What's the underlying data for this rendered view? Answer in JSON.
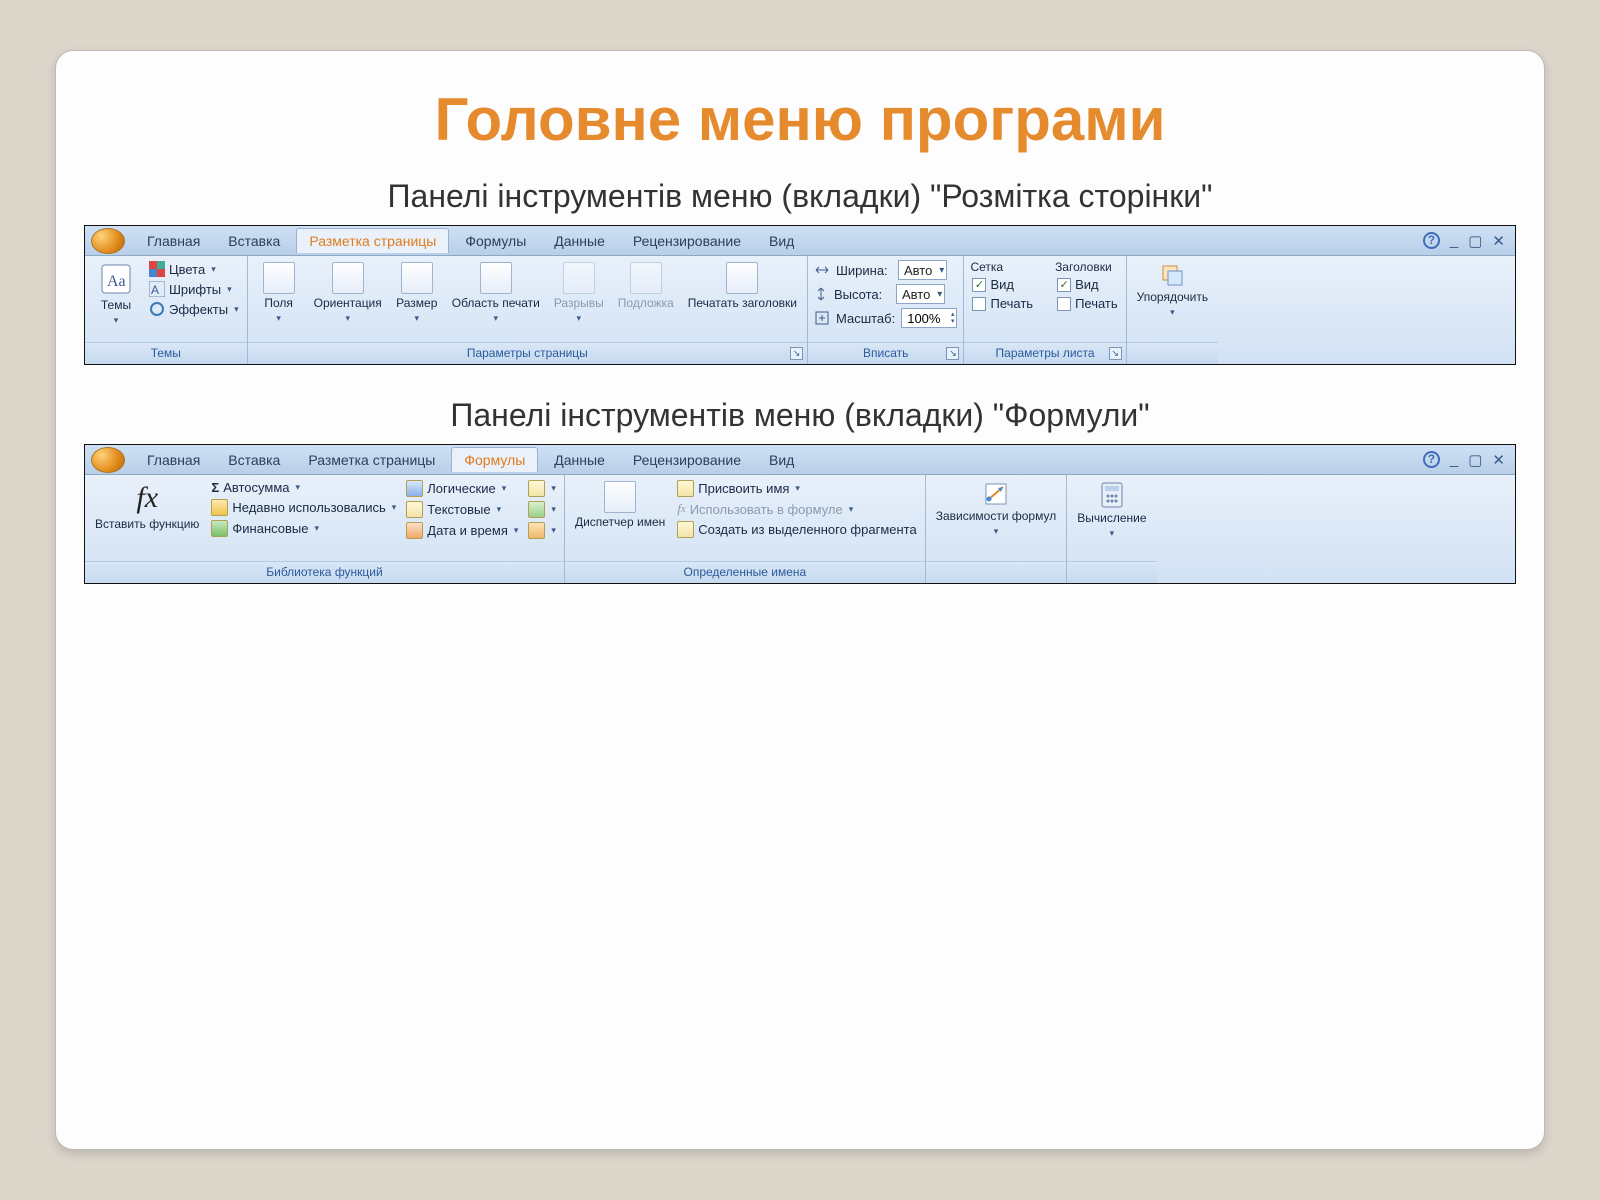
{
  "title": "Головне меню програми",
  "subtitle1": "Панелі інструментів меню (вкладки) \"Розмітка сторінки\"",
  "subtitle2": "Панелі інструментів меню (вкладки) \"Формули\"",
  "tabs": {
    "home": "Главная",
    "insert": "Вставка",
    "pagelayout": "Разметка страницы",
    "formulas": "Формулы",
    "data": "Данные",
    "review": "Рецензирование",
    "view": "Вид"
  },
  "win": {
    "help": "?",
    "min": "_",
    "max": "▢",
    "close": "✕"
  },
  "r1": {
    "themes": {
      "themes_btn": "Темы",
      "colors": "Цвета",
      "fonts": "Шрифты",
      "effects": "Эффекты",
      "group": "Темы"
    },
    "pagesetup": {
      "margins": "Поля",
      "orientation": "Ориентация",
      "size": "Размер",
      "printarea": "Область печати",
      "breaks": "Разрывы",
      "background": "Подложка",
      "printtitles": "Печатать заголовки",
      "group": "Параметры страницы"
    },
    "scale": {
      "width_lbl": "Ширина:",
      "height_lbl": "Высота:",
      "scale_lbl": "Масштаб:",
      "auto": "Авто",
      "scale_val": "100%",
      "group": "Вписать"
    },
    "sheetopts": {
      "grid_hdr": "Сетка",
      "titles_hdr": "Заголовки",
      "view": "Вид",
      "print": "Печать",
      "group": "Параметры листа"
    },
    "arrange": {
      "btn": "Упорядочить"
    }
  },
  "r2": {
    "insertfn": {
      "label": "Вставить функцию"
    },
    "lib": {
      "autosum": "Автосумма",
      "recent": "Недавно использовались",
      "financial": "Финансовые",
      "logical": "Логические",
      "text": "Текстовые",
      "datetime": "Дата и время",
      "group": "Библиотека функций"
    },
    "names": {
      "manager": "Диспетчер имен",
      "define": "Присвоить имя",
      "useinformula": "Использовать в формуле",
      "createfromsel": "Создать из выделенного фрагмента",
      "group": "Определенные имена"
    },
    "audit": {
      "deps": "Зависимости формул"
    },
    "calc": {
      "label": "Вычисление"
    }
  }
}
